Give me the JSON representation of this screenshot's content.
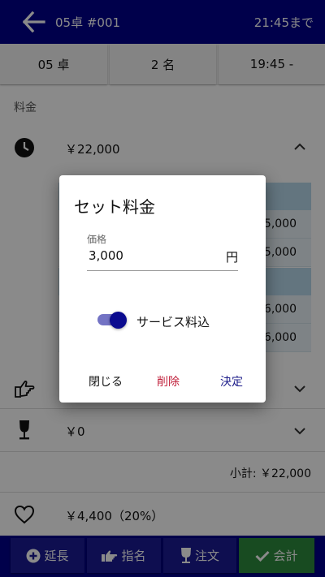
{
  "header": {
    "title": "05卓 #001",
    "until": "21:45まで"
  },
  "info": {
    "table": "05 卓",
    "guests": "2 名",
    "time": "19:45 -"
  },
  "section_label": "料金",
  "fee": {
    "amount": "￥22,000"
  },
  "subtable_amounts": [
    "5,000",
    "5,000",
    "6,000",
    "6,000"
  ],
  "drink": {
    "amount": "￥0"
  },
  "subtotal": "小計: ￥22,000",
  "service": {
    "amount": "￥4,400（20%）"
  },
  "bottom": {
    "extend": "延長",
    "nominate": "指名",
    "order": "注文",
    "checkout": "会計"
  },
  "dialog": {
    "title": "セット料金",
    "field_label": "価格",
    "field_value": "3,000",
    "field_unit": "円",
    "toggle_label": "サービス料込",
    "toggle_on": true,
    "close": "閉じる",
    "delete": "削除",
    "ok": "決定"
  },
  "colors": {
    "primary": "#00008b",
    "checkout": "#2e8b3e",
    "delete": "#c0203b",
    "highlight": "#b8d8ea"
  }
}
